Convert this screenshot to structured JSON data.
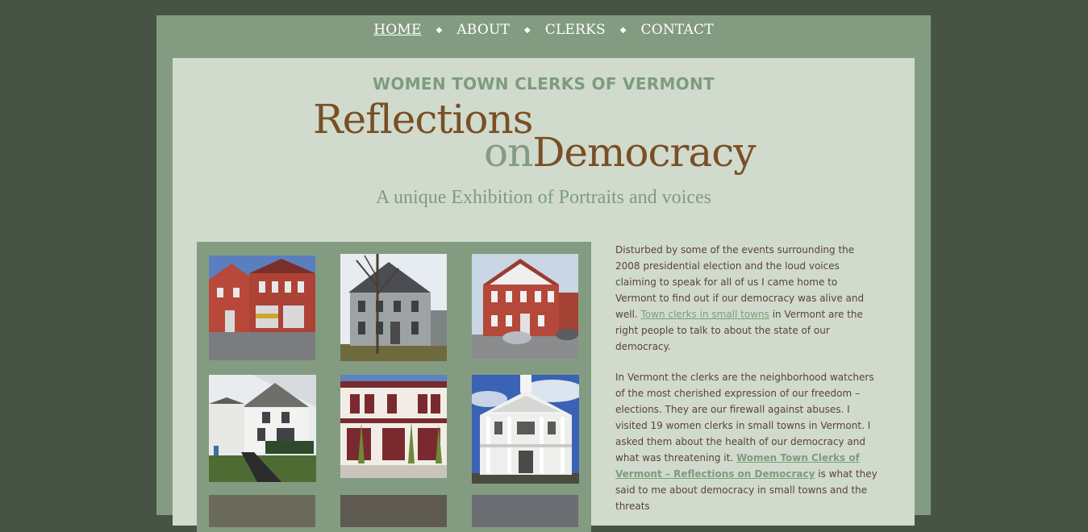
{
  "nav": {
    "items": [
      "HOME",
      "ABOUT",
      "CLERKS",
      "CONTACT"
    ],
    "separator": "◆",
    "active_index": 0
  },
  "header": {
    "kicker": "WOMEN TOWN CLERKS OF VERMONT",
    "title_line1": "Reflections",
    "title_on": "on",
    "title_democracy": "Democracy",
    "tagline": "A unique Exhibition of Portraits and voices"
  },
  "gallery": {
    "items": [
      "red-brick-fire-station",
      "gray-clapboard-house",
      "red-brick-town-hall",
      "white-farmhouse",
      "red-two-story-storefront",
      "white-columned-meeting-house"
    ]
  },
  "body": {
    "p1_a": "Disturbed by some of the events surrounding the 2008 presidential election and the loud voices claiming to speak for all of us I came home to Vermont to find out if our democracy was alive and well. ",
    "p1_link": "Town clerks in small towns",
    "p1_b": " in Vermont are the right people to talk to about the state of our democracy.",
    "p2_a": "In Vermont the clerks are the neighborhood watchers of the most cherished expression of our freedom – elections. They are our firewall against abuses. I visited 19 women clerks in small towns in Vermont. I asked them about the health of our democracy and what was threatening it. ",
    "p2_link": "Women Town Clerks of Vermont – Reflections on Democracy",
    "p2_b": " is what they said to me about democracy in small towns and the threats"
  },
  "colors": {
    "page_bg": "#465345",
    "frame_bg": "#839c81",
    "panel_bg": "#d0dbcd",
    "title_brown": "#7a4f25",
    "sage": "#7d9d7c"
  }
}
